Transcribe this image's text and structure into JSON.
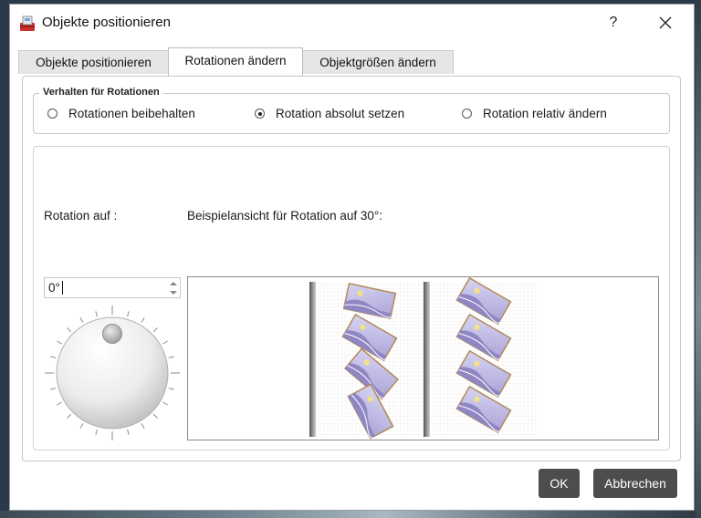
{
  "window": {
    "title": "Objekte positionieren",
    "help_label": "?"
  },
  "tabs": [
    {
      "label": "Objekte positionieren",
      "active": false
    },
    {
      "label": "Rotationen ändern",
      "active": true
    },
    {
      "label": "Objektgrößen ändern",
      "active": false
    }
  ],
  "rotation_behavior": {
    "legend": "Verhalten für Rotationen",
    "options": [
      {
        "label": "Rotationen beibehalten",
        "checked": false
      },
      {
        "label": "Rotation absolut setzen",
        "checked": true
      },
      {
        "label": "Rotation relativ ändern",
        "checked": false
      }
    ]
  },
  "rotation": {
    "label": "Rotation auf :",
    "value": "0°"
  },
  "preview": {
    "label": "Beispielansicht für Rotation auf 30°:"
  },
  "buttons": {
    "ok": "OK",
    "cancel": "Abbrechen"
  },
  "colors": {
    "button_bg": "#4d4d4d",
    "photo_tint": "#b9b3e0"
  }
}
